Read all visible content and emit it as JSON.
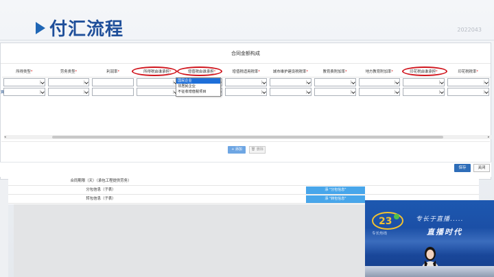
{
  "slide": {
    "title": "付汇流程",
    "code": "2022043"
  },
  "dialog": {
    "title": "合同金额构成",
    "row_marker": "算",
    "columns": [
      {
        "label": "所得类型",
        "required": "*"
      },
      {
        "label": "劳务类型",
        "required": "*"
      },
      {
        "label": "利润率",
        "required": "*"
      },
      {
        "label": "所得税由谁承担",
        "required": "*"
      },
      {
        "label": "增值税由谁承担",
        "required": "*"
      },
      {
        "label": "增值税适用税率",
        "required": "*"
      },
      {
        "label": "城市维护建设税税率",
        "required": "*"
      },
      {
        "label": "教育费附加率",
        "required": "*"
      },
      {
        "label": "地方教育附加率",
        "required": "*"
      },
      {
        "label": "印花税由谁承担",
        "required": "*"
      },
      {
        "label": "印花税税率",
        "required": "*"
      }
    ],
    "dropdown_options": [
      "国民企业",
      "非居民企业",
      "不征收增值税项目"
    ],
    "add_button": "添加",
    "delete_button": "删除",
    "scroll_left": "◂",
    "scroll_right": "▸"
  },
  "footer": {
    "save_button": "保存",
    "close_button": "关闭"
  },
  "form": {
    "contract_period_label": "合同期限（天）（承包工程提供劳务）",
    "subcontract_label": "分包信息（子表）",
    "subcontract_button": "添 \"分包信息\"",
    "transfer_label": "转包信息（子表）",
    "transfer_button": "添 \"转包信息\""
  },
  "video": {
    "overlay_text_1": "专长于直播.....",
    "overlay_text_2": "直播时代",
    "overlay_small": "专长热线",
    "logo_text": "23"
  },
  "colors": {
    "title_blue": "#1f4f9a",
    "highlight_red": "#d0141c",
    "primary_button": "#2e6db8",
    "info_button": "#48a6ea"
  }
}
